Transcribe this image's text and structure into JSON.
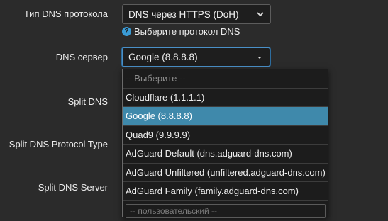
{
  "form": {
    "protocol": {
      "label": "Тип DNS протокола",
      "value": "DNS через HTTPS (DoH)",
      "hint": "Выберите протокол DNS"
    },
    "server": {
      "label": "DNS сервер",
      "value": "Google (8.8.8.8)"
    },
    "split_dns": {
      "label": "Split DNS"
    },
    "split_protocol": {
      "label": "Split DNS Protocol Type"
    },
    "split_server": {
      "label": "Split DNS Server"
    }
  },
  "dropdown": {
    "placeholder": "-- Выберите --",
    "options": [
      "Cloudflare (1.1.1.1)",
      "Google (8.8.8.8)",
      "Quad9 (9.9.9.9)",
      "AdGuard Default (dns.adguard-dns.com)",
      "AdGuard Unfiltered (unfiltered.adguard-dns.com)",
      "AdGuard Family (family.adguard-dns.com)"
    ],
    "selected_index": 1,
    "custom_placeholder": "-- пользовательский --"
  }
}
